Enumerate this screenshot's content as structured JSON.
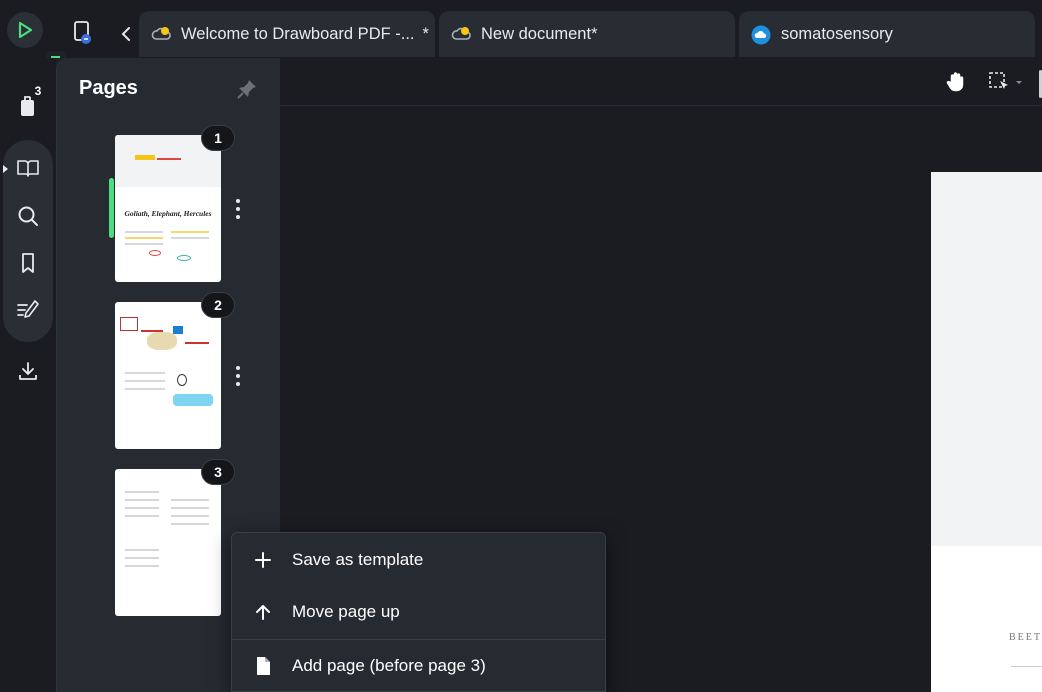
{
  "tabs": [
    {
      "label": "Welcome to Drawboard PDF -...",
      "modified": "*",
      "icon": "cloud-sync-icon"
    },
    {
      "label": "New document",
      "modified": "*",
      "icon": "cloud-sync-icon"
    },
    {
      "label": "somatosensory",
      "modified": "",
      "icon": "cloud-icon"
    }
  ],
  "rail": {
    "open_docs_count": "3",
    "items": [
      "documents-icon",
      "book-icon",
      "search-icon",
      "bookmark-icon",
      "annotations-icon",
      "download-icon"
    ]
  },
  "pages_panel": {
    "title": "Pages",
    "pages": [
      {
        "number": "1",
        "thumb_title": "Goliath, Elephant, Hercules"
      },
      {
        "number": "2"
      },
      {
        "number": "3"
      }
    ]
  },
  "document": {
    "visible_text": "BEET"
  },
  "context_menu": {
    "items": [
      {
        "label": "Save as template",
        "icon": "plus-icon"
      },
      {
        "label": "Move page up",
        "icon": "arrow-up-icon"
      },
      {
        "label": "Add page (before page 3)",
        "icon": "new-page-icon"
      }
    ]
  },
  "colors": {
    "accent_green": "#4ade80",
    "app_bg": "#1a1c21",
    "panel_bg": "#262a31",
    "cloud_blue": "#1e90e0",
    "sync_yellow": "#f5c518"
  }
}
